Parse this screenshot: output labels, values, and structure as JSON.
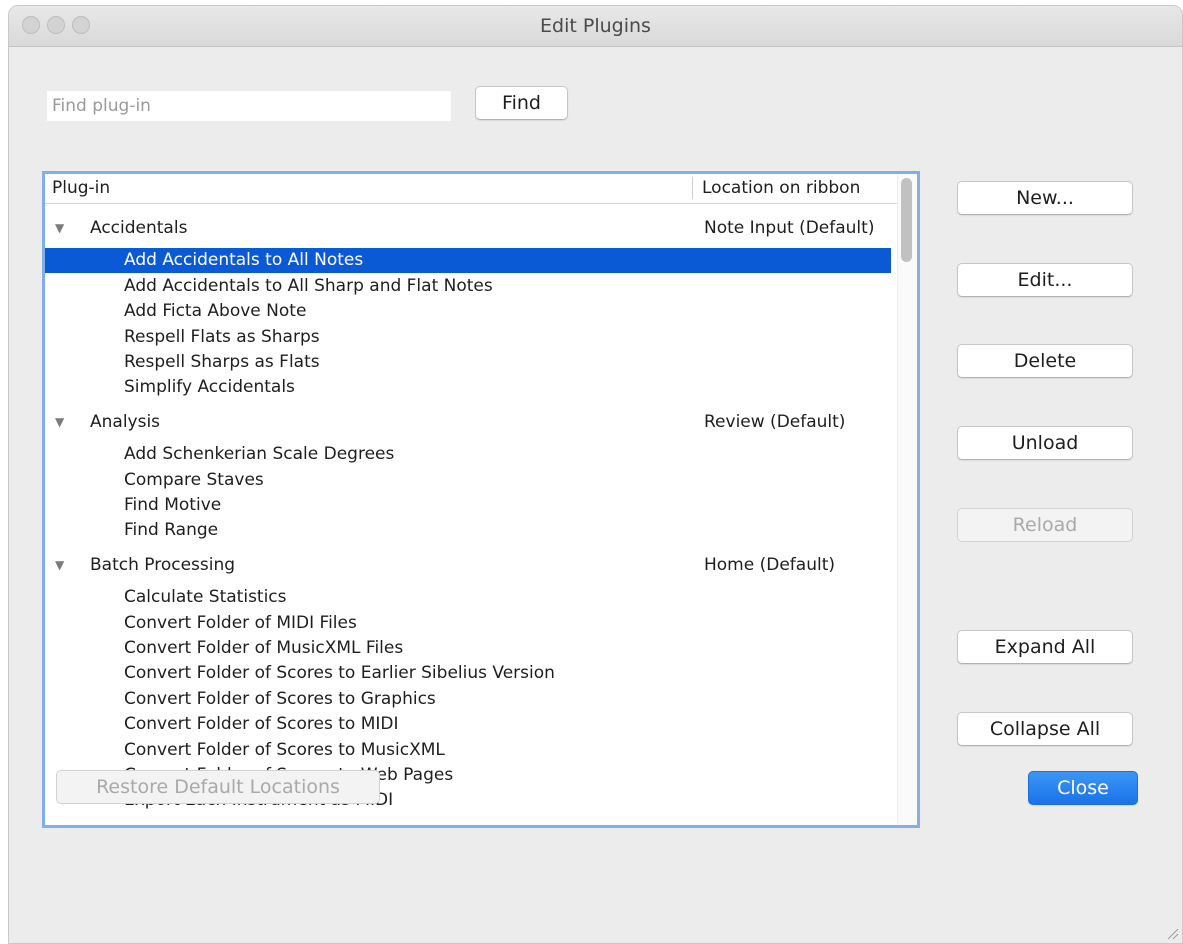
{
  "window": {
    "title": "Edit Plugins"
  },
  "search": {
    "placeholder": "Find plug-in",
    "value": ""
  },
  "find_button": "Find",
  "list": {
    "headers": {
      "plugin": "Plug-in",
      "location": "Location on ribbon"
    },
    "categories": [
      {
        "name": "Accidentals",
        "location": "Note Input (Default)",
        "expanded": true,
        "items": [
          "Add Accidentals to All Notes",
          "Add Accidentals to All Sharp and Flat Notes",
          "Add Ficta Above Note",
          "Respell Flats as Sharps",
          "Respell Sharps as Flats",
          "Simplify Accidentals"
        ]
      },
      {
        "name": "Analysis",
        "location": "Review (Default)",
        "expanded": true,
        "items": [
          "Add Schenkerian Scale Degrees",
          "Compare Staves",
          "Find Motive",
          "Find Range"
        ]
      },
      {
        "name": "Batch Processing",
        "location": "Home (Default)",
        "expanded": true,
        "items": [
          "Calculate Statistics",
          "Convert Folder of MIDI Files",
          "Convert Folder of MusicXML Files",
          "Convert Folder of Scores to Earlier Sibelius Version",
          "Convert Folder of Scores to Graphics",
          "Convert Folder of Scores to MIDI",
          "Convert Folder of Scores to MusicXML",
          "Convert Folder of Scores to Web Pages",
          "Export Each Instrument as MIDI"
        ]
      }
    ],
    "selected": "Add Accidentals to All Notes"
  },
  "side_buttons": {
    "new": "New...",
    "edit": "Edit...",
    "delete": "Delete",
    "unload": "Unload",
    "reload": "Reload",
    "expand_all": "Expand All",
    "collapse_all": "Collapse All"
  },
  "restore_button": "Restore Default Locations",
  "close_button": "Close",
  "colors": {
    "selection": "#0b5ad5",
    "primary": "#1a73e8",
    "focus_ring": "#7fb0ea"
  }
}
